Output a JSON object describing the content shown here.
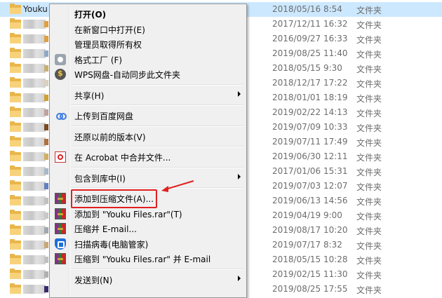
{
  "files": [
    {
      "name": "Youku",
      "date": "2018/05/16 8:54",
      "type": "文件夹",
      "selected": true,
      "accent": ""
    },
    {
      "name": "",
      "date": "2017/12/11 16:32",
      "type": "文件夹",
      "accent": "#e0a040"
    },
    {
      "name": "",
      "date": "2016/09/27 16:33",
      "type": "文件夹",
      "accent": "#e0a040"
    },
    {
      "name": "",
      "date": "2019/08/25 11:40",
      "type": "文件夹",
      "accent": "#8fa8c8"
    },
    {
      "name": "",
      "date": "2018/05/15 9:30",
      "type": "文件夹",
      "accent": "#c8b070"
    },
    {
      "name": "",
      "date": "2018/12/17 17:22",
      "type": "文件夹",
      "accent": "#d9d0c0"
    },
    {
      "name": "",
      "date": "2018/01/01 18:19",
      "type": "文件夹",
      "accent": "#d0a030"
    },
    {
      "name": "",
      "date": "2019/02/22 14:13",
      "type": "文件夹",
      "accent": "#c0a0a0"
    },
    {
      "name": "",
      "date": "2019/07/09 10:33",
      "type": "文件夹",
      "accent": "#7a4a20"
    },
    {
      "name": "",
      "date": "2019/07/11 17:49",
      "type": "文件夹",
      "accent": "#b07040"
    },
    {
      "name": "",
      "date": "2019/06/30 12:11",
      "type": "文件夹",
      "accent": "#d0b060"
    },
    {
      "name": "",
      "date": "2017/01/06 15:31",
      "type": "文件夹",
      "accent": "#a8b8c8"
    },
    {
      "name": "",
      "date": "2019/07/03 12:07",
      "type": "文件夹",
      "accent": "#6080c0"
    },
    {
      "name": "",
      "date": "2019/06/13 14:56",
      "type": "文件夹",
      "accent": "#c0c0c0"
    },
    {
      "name": "",
      "date": "2019/04/19 9:00",
      "type": "文件夹",
      "accent": "#c8c8c8"
    },
    {
      "name": "",
      "date": "2019/08/17 10:20",
      "type": "文件夹",
      "accent": "#a0a8b0"
    },
    {
      "name": "",
      "date": "2019/07/17 8:32",
      "type": "文件夹",
      "accent": "#c8a878"
    },
    {
      "name": "",
      "date": "2018/05/15 10:28",
      "type": "文件夹",
      "accent": "#c0c0c0"
    },
    {
      "name": "",
      "date": "2019/02/15 11:30",
      "type": "文件夹",
      "accent": "#b0b0b0"
    },
    {
      "name": "",
      "date": "2019/08/25 17:55",
      "type": "文件夹",
      "accent": "#3a2a6a"
    }
  ],
  "menu": [
    {
      "kind": "item",
      "label": "打开(O)",
      "bold": true,
      "icon": ""
    },
    {
      "kind": "item",
      "label": "在新窗口中打开(E)",
      "icon": ""
    },
    {
      "kind": "item",
      "label": "管理员取得所有权",
      "icon": ""
    },
    {
      "kind": "item",
      "label": "格式工厂 (F)",
      "icon": "format-factory-icon"
    },
    {
      "kind": "item",
      "label": "WPS网盘-自动同步此文件夹",
      "icon": "wps-drive-icon"
    },
    {
      "kind": "sep"
    },
    {
      "kind": "item",
      "label": "共享(H)",
      "submenu": true,
      "icon": ""
    },
    {
      "kind": "sep"
    },
    {
      "kind": "item",
      "label": "上传到百度网盘",
      "icon": "baidu-netdisk-icon"
    },
    {
      "kind": "sep"
    },
    {
      "kind": "item",
      "label": "还原以前的版本(V)",
      "icon": ""
    },
    {
      "kind": "sep"
    },
    {
      "kind": "item",
      "label": "在 Acrobat 中合并文件...",
      "icon": "acrobat-icon"
    },
    {
      "kind": "sep"
    },
    {
      "kind": "item",
      "label": "包含到库中(I)",
      "submenu": true,
      "icon": ""
    },
    {
      "kind": "sep"
    },
    {
      "kind": "item",
      "label": "添加到压缩文件(A)...",
      "icon": "winrar-icon",
      "highlighted": true
    },
    {
      "kind": "item",
      "label": "添加到 \"Youku Files.rar\"(T)",
      "icon": "winrar-icon"
    },
    {
      "kind": "item",
      "label": "压缩并 E-mail...",
      "icon": "winrar-icon"
    },
    {
      "kind": "item",
      "label": "扫描病毒(电脑管家)",
      "icon": "pc-manager-shield-icon"
    },
    {
      "kind": "item",
      "label": "压缩到 \"Youku Files.rar\" 并 E-mail",
      "icon": "winrar-icon"
    },
    {
      "kind": "sep"
    },
    {
      "kind": "item",
      "label": "发送到(N)",
      "submenu": true,
      "icon": ""
    }
  ],
  "colors": {
    "selection": "#cce8ff",
    "annotation": "#e02020"
  }
}
